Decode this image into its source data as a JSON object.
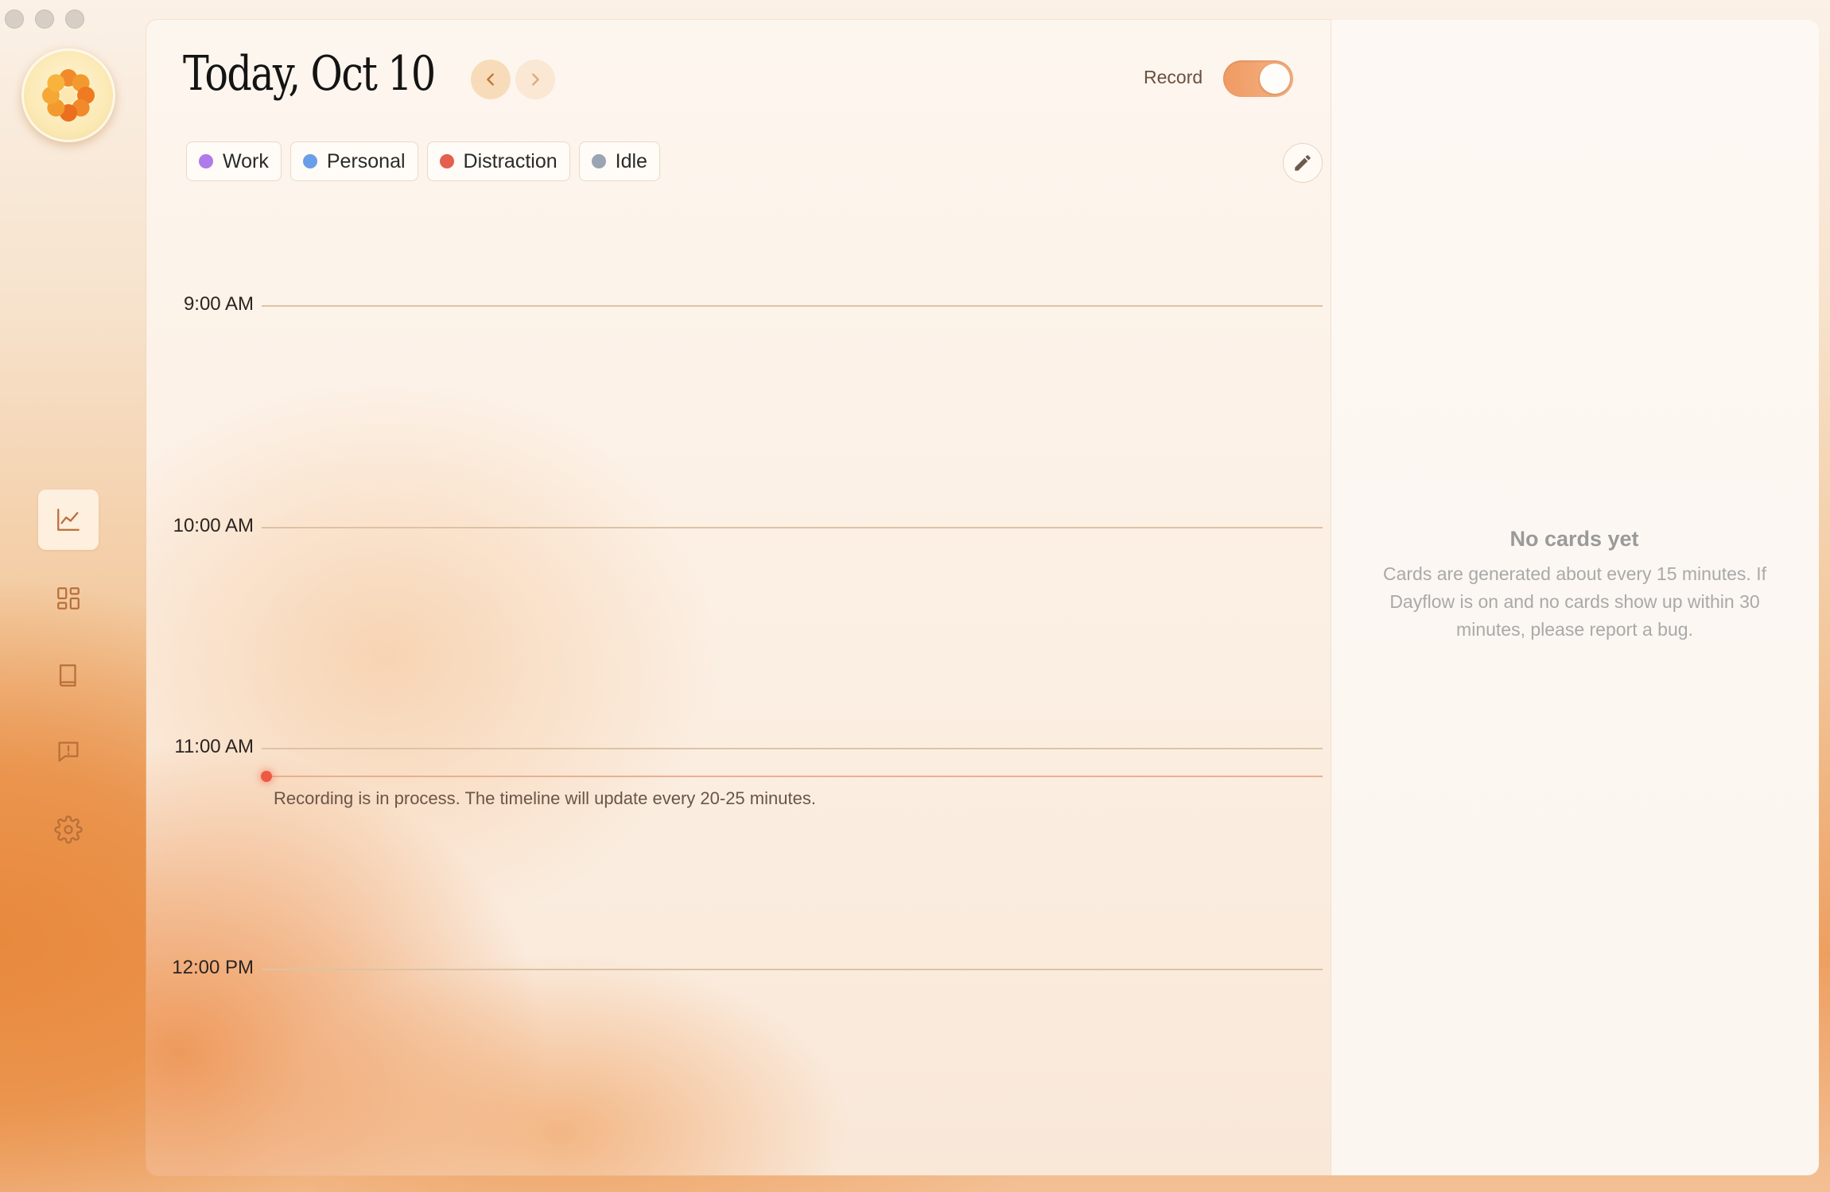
{
  "window": {
    "controls": [
      "close",
      "minimize",
      "zoom"
    ]
  },
  "sidebar": {
    "logo_icon": "flower-logo-icon",
    "items": [
      {
        "id": "timeline",
        "icon": "chart-line-icon",
        "active": true
      },
      {
        "id": "dashboard",
        "icon": "dashboard-grid-icon",
        "active": false
      },
      {
        "id": "journal",
        "icon": "book-icon",
        "active": false
      },
      {
        "id": "feedback",
        "icon": "feedback-bubble-icon",
        "active": false
      },
      {
        "id": "settings",
        "icon": "gear-icon",
        "active": false
      }
    ]
  },
  "header": {
    "date_title": "Today, Oct 10",
    "prev_icon": "chevron-left-icon",
    "next_icon": "chevron-right-icon",
    "record_label": "Record",
    "record_on": true
  },
  "categories": [
    {
      "label": "Work",
      "color": "#b07be8"
    },
    {
      "label": "Personal",
      "color": "#6a9ee8"
    },
    {
      "label": "Distraction",
      "color": "#e35f4f"
    },
    {
      "label": "Idle",
      "color": "#9aa4b2"
    }
  ],
  "edit_icon": "pencil-icon",
  "timeline": {
    "hours": [
      "9:00 AM",
      "10:00 AM",
      "11:00 AM",
      "12:00 PM"
    ],
    "recording_note": "Recording is in process. The timeline will update every 20-25 minutes."
  },
  "cards_panel": {
    "empty_title": "No cards yet",
    "empty_body": "Cards are generated about every 15 minutes. If Dayflow is on and no cards show up within 30 minutes, please report a bug."
  },
  "colors": {
    "accent": "#f09a63",
    "now_marker": "#ec5a43"
  }
}
